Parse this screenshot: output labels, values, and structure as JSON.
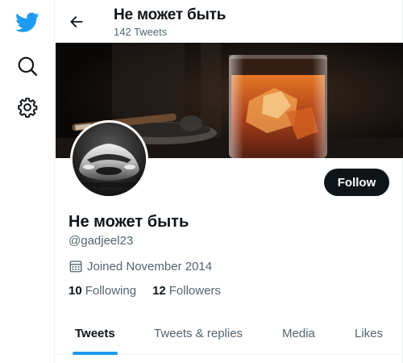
{
  "nav": {
    "logo_icon": "twitter-bird-icon",
    "search_icon": "search-icon",
    "settings_icon": "gear-icon"
  },
  "header": {
    "title": "Не может быть",
    "subtitle": "142 Tweets",
    "back_icon": "arrow-left-icon"
  },
  "profile": {
    "name": "Не может быть",
    "handle": "@gadjeel23",
    "joined": "Joined November 2014",
    "following_count": "10",
    "following_label": "Following",
    "followers_count": "12",
    "followers_label": "Followers",
    "follow_label": "Follow"
  },
  "tabs": [
    {
      "label": "Tweets",
      "active": true
    },
    {
      "label": "Tweets & replies",
      "active": false
    },
    {
      "label": "Media",
      "active": false
    },
    {
      "label": "Likes",
      "active": false
    }
  ],
  "colors": {
    "accent": "#1d9bf0",
    "text": "#0f1419",
    "muted": "#536471",
    "button": "#0f1419"
  }
}
